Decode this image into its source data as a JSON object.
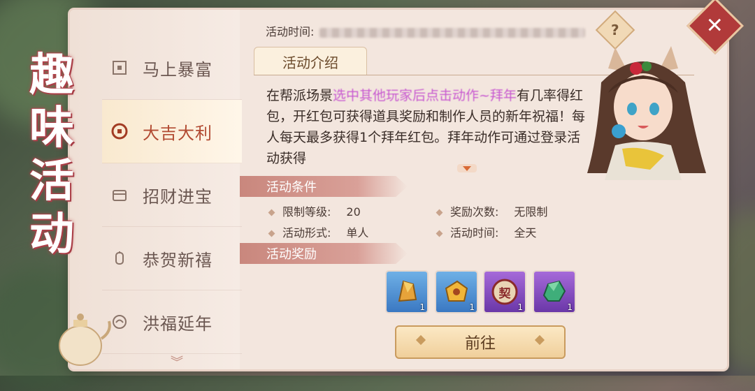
{
  "title_chars": [
    "趣",
    "味",
    "活",
    "动"
  ],
  "nav": {
    "items": [
      {
        "label": "马上暴富",
        "icon": "coin-frame-icon"
      },
      {
        "label": "大吉大利",
        "icon": "coin-icon",
        "active": true
      },
      {
        "label": "招财进宝",
        "icon": "chest-icon"
      },
      {
        "label": "恭贺新禧",
        "icon": "lantern-icon"
      },
      {
        "label": "洪福延年",
        "icon": "fortune-icon"
      }
    ]
  },
  "header": {
    "time_label": "活动时间:",
    "help": "?",
    "close": "✕"
  },
  "intro": {
    "tab_label": "活动介绍",
    "text_before": "在帮派场景",
    "text_highlight": "选中其他玩家后点击动作~拜年",
    "text_after": "有几率得红包，开红包可获得道具奖励和制作人员的新年祝福！每人每天最多获得1个拜年红包。拜年动作可通过登录活动获得"
  },
  "conditions": {
    "title": "活动条件",
    "items": [
      {
        "label": "限制等级:",
        "value": "20"
      },
      {
        "label": "奖励次数:",
        "value": "无限制"
      },
      {
        "label": "活动形式:",
        "value": "单人"
      },
      {
        "label": "活动时间:",
        "value": "全天"
      }
    ]
  },
  "rewards": {
    "title": "活动奖励",
    "items": [
      {
        "name": "gold-crystal-item",
        "count": "1",
        "color": "#4a8ed6"
      },
      {
        "name": "gold-box-item",
        "count": "1",
        "color": "#4a8ed6"
      },
      {
        "name": "contract-seal-item",
        "count": "1",
        "color": "#8e4bc5",
        "glyph": "契"
      },
      {
        "name": "jade-stone-item",
        "count": "1",
        "color": "#8e4bc5"
      }
    ]
  },
  "go_label": "前往"
}
